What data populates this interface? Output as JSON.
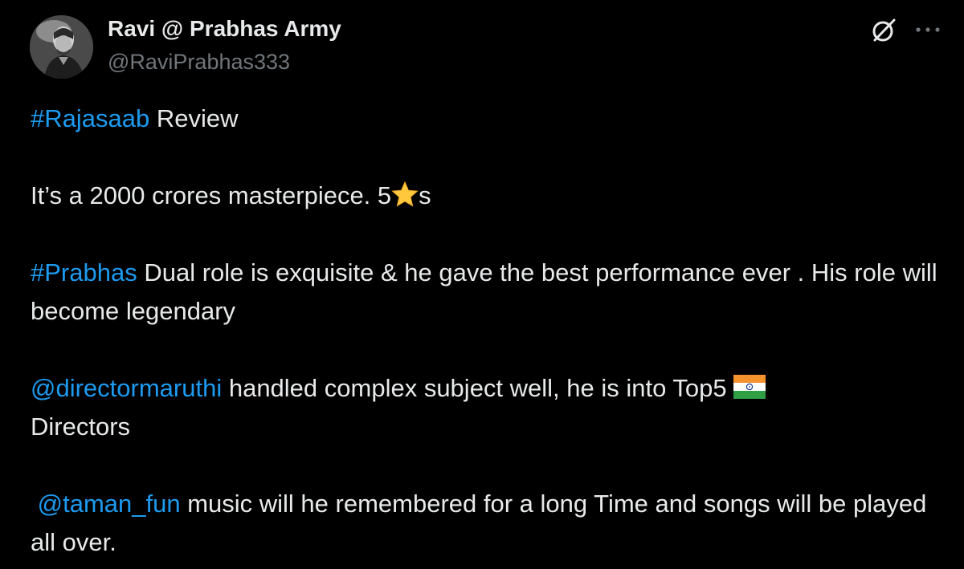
{
  "author": {
    "display_name": "Ravi @ Prabhas Army",
    "handle": "@RaviPrabhas333"
  },
  "icons": {
    "grok": "grok-icon",
    "more": "more-options-icon",
    "star": "star-emoji",
    "flag": "india-flag-emoji"
  },
  "colors": {
    "background": "#000000",
    "text": "#e7e9ea",
    "handle": "#71767b",
    "link": "#1d9bf0"
  },
  "tweet": {
    "p1": {
      "hashtag": "#Rajasaab",
      "text": " Review"
    },
    "p2": {
      "text_before": "It’s a 2000 crores masterpiece. 5",
      "text_after": "s"
    },
    "p3": {
      "hashtag": "#Prabhas",
      "text": " Dual role is exquisite & he gave the best performance ever . His role will become legendary"
    },
    "p4": {
      "mention": "@directormaruthi",
      "text": " handled complex subject well, he is into Top5",
      "text_after": "Directors"
    },
    "p5": {
      "leading": " ",
      "mention": "@taman_fun",
      "text": " music will he remembered for a long Time and songs will be played all over."
    }
  }
}
